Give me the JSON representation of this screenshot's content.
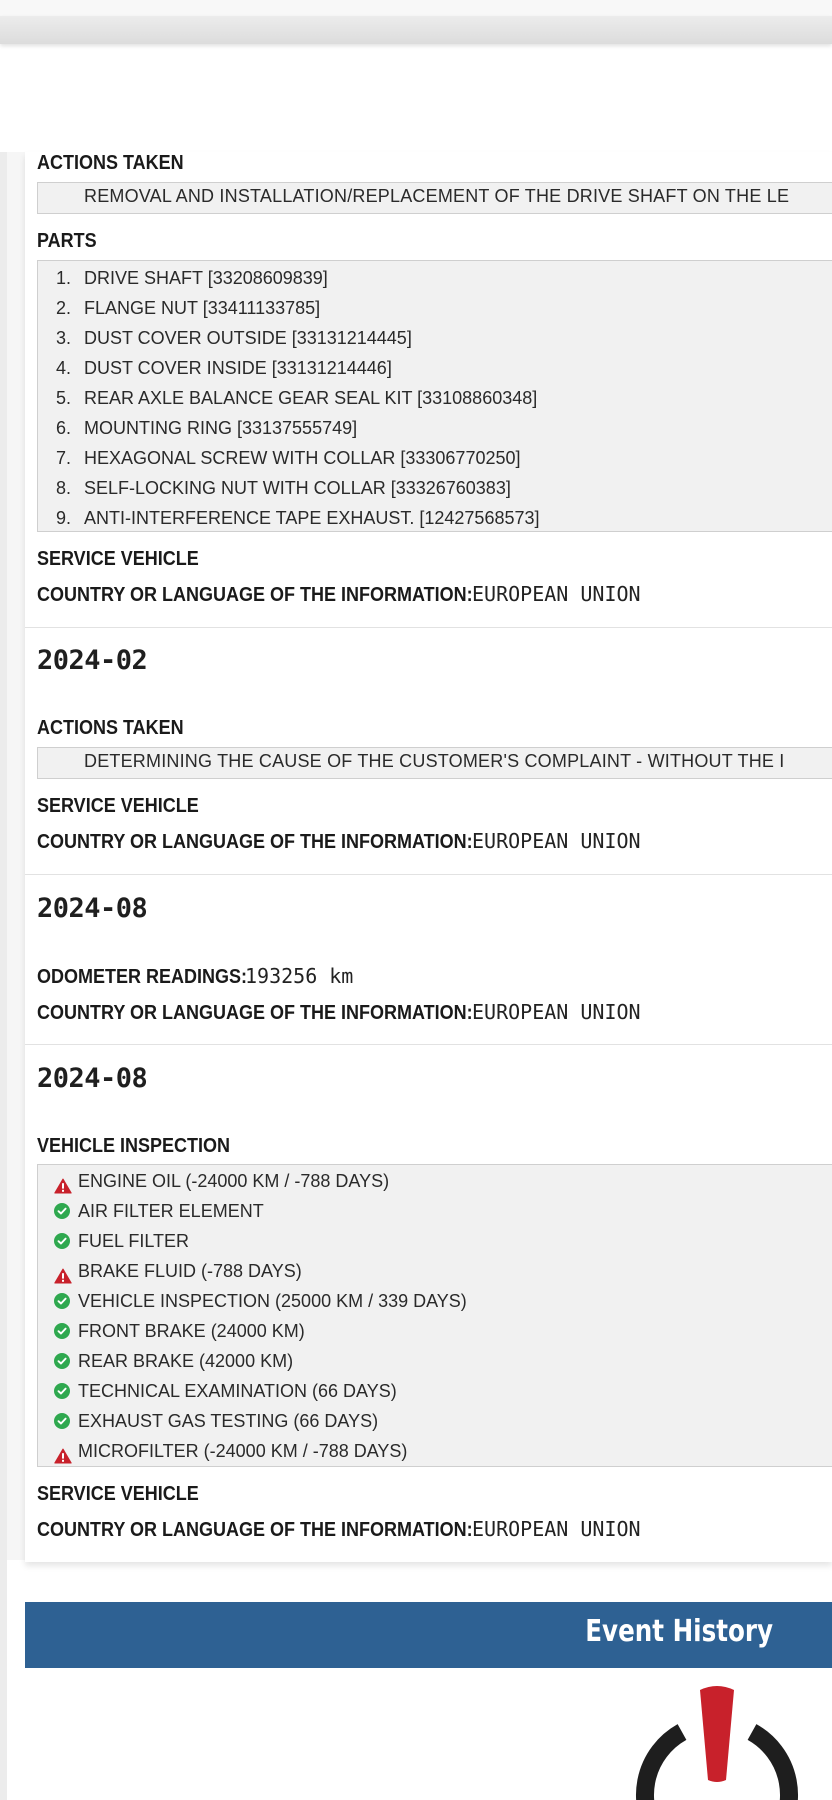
{
  "entry1": {
    "actions_label": "ACTIONS TAKEN",
    "actions_text": "REMOVAL AND INSTALLATION/REPLACEMENT OF THE DRIVE SHAFT ON THE LE",
    "parts_label": "PARTS",
    "parts": [
      {
        "num": "1.",
        "text": "DRIVE SHAFT [33208609839]"
      },
      {
        "num": "2.",
        "text": "FLANGE NUT [33411133785]"
      },
      {
        "num": "3.",
        "text": "DUST COVER OUTSIDE [33131214445]"
      },
      {
        "num": "4.",
        "text": "DUST COVER INSIDE [33131214446]"
      },
      {
        "num": "5.",
        "text": "REAR AXLE BALANCE GEAR SEAL KIT [33108860348]"
      },
      {
        "num": "6.",
        "text": "MOUNTING RING [33137555749]"
      },
      {
        "num": "7.",
        "text": "HEXAGONAL SCREW WITH COLLAR [33306770250]"
      },
      {
        "num": "8.",
        "text": "SELF-LOCKING NUT WITH COLLAR [33326760383]"
      },
      {
        "num": "9.",
        "text": "ANTI-INTERFERENCE TAPE EXHAUST. [12427568573]"
      }
    ],
    "service_label": "SERVICE VEHICLE",
    "country_label": "COUNTRY OR LANGUAGE OF THE INFORMATION:",
    "country_value": "EUROPEAN UNION"
  },
  "entry2": {
    "date": "2024-02",
    "actions_label": "ACTIONS TAKEN",
    "actions_text": "DETERMINING THE CAUSE OF THE CUSTOMER'S COMPLAINT - WITHOUT THE I",
    "service_label": "SERVICE VEHICLE",
    "country_label": "COUNTRY OR LANGUAGE OF THE INFORMATION:",
    "country_value": "EUROPEAN UNION"
  },
  "entry3": {
    "date": "2024-08",
    "odometer_label": "ODOMETER READINGS:",
    "odometer_value": "193256",
    "odometer_unit": "km",
    "country_label": "COUNTRY OR LANGUAGE OF THE INFORMATION:",
    "country_value": "EUROPEAN UNION"
  },
  "entry4": {
    "date": "2024-08",
    "inspection_label": "VEHICLE INSPECTION",
    "inspection_items": [
      {
        "status": "warning-icon",
        "text": "ENGINE OIL (-24000 KM / -788 DAYS)"
      },
      {
        "status": "check-icon",
        "text": "AIR FILTER ELEMENT"
      },
      {
        "status": "check-icon",
        "text": "FUEL FILTER"
      },
      {
        "status": "warning-icon",
        "text": "BRAKE FLUID (-788 DAYS)"
      },
      {
        "status": "check-icon",
        "text": "VEHICLE INSPECTION (25000 KM / 339 DAYS)"
      },
      {
        "status": "check-icon",
        "text": "FRONT BRAKE (24000 KM)"
      },
      {
        "status": "check-icon",
        "text": "REAR BRAKE (42000 KM)"
      },
      {
        "status": "check-icon",
        "text": "TECHNICAL EXAMINATION (66 DAYS)"
      },
      {
        "status": "check-icon",
        "text": "EXHAUST GAS TESTING (66 DAYS)"
      },
      {
        "status": "warning-icon",
        "text": "MICROFILTER (-24000 KM / -788 DAYS)"
      }
    ],
    "service_label": "SERVICE VEHICLE",
    "country_label": "COUNTRY OR LANGUAGE OF THE INFORMATION:",
    "country_value": "EUROPEAN UNION"
  },
  "event_history": {
    "title": "Event History",
    "icon": "alert-power-icon"
  },
  "colors": {
    "header_blue": "#2e6193",
    "check_green": "#2fa84f",
    "warning_red": "#c8212b",
    "icon_dark": "#1e1e1e"
  }
}
